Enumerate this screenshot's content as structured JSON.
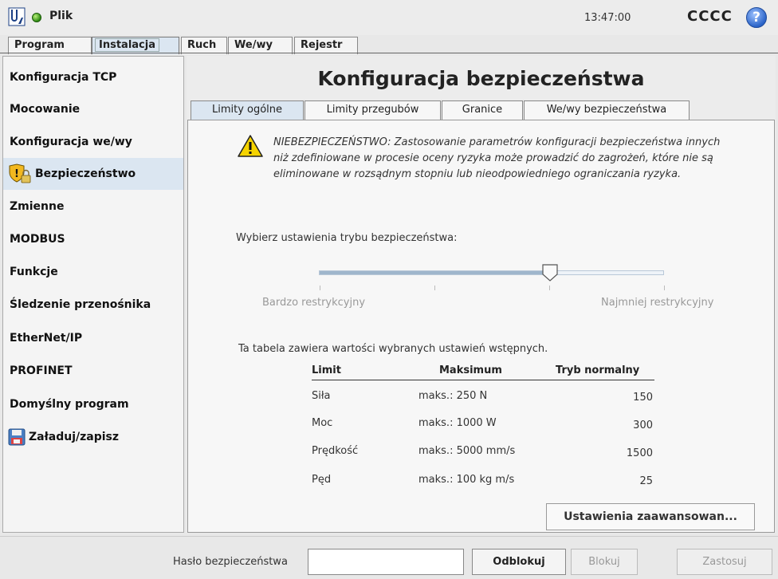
{
  "header": {
    "file_menu": "Plik",
    "clock": "13:47:00",
    "robot_name": "CCCC",
    "help": "?"
  },
  "main_tabs": [
    {
      "label": "Program"
    },
    {
      "label": "Instalacja"
    },
    {
      "label": "Ruch"
    },
    {
      "label": "We/wy"
    },
    {
      "label": "Rejestr"
    }
  ],
  "sidebar": {
    "items": [
      {
        "label": "Konfiguracja TCP"
      },
      {
        "label": "Mocowanie"
      },
      {
        "label": "Konfiguracja we/wy"
      },
      {
        "label": "Bezpieczeństwo"
      },
      {
        "label": "Zmienne"
      },
      {
        "label": "MODBUS"
      },
      {
        "label": "Funkcje"
      },
      {
        "label": "Śledzenie przenośnika"
      },
      {
        "label": "EtherNet/IP"
      },
      {
        "label": "PROFINET"
      },
      {
        "label": "Domyślny program"
      },
      {
        "label": "Załaduj/zapisz"
      }
    ]
  },
  "page": {
    "title": "Konfiguracja bezpieczeństwa",
    "sub_tabs": [
      {
        "label": "Limity ogólne"
      },
      {
        "label": "Limity przegubów"
      },
      {
        "label": "Granice"
      },
      {
        "label": "We/wy bezpieczeństwa"
      }
    ],
    "warning": "NIEBEZPIECZEŃSTWO: Zastosowanie parametrów konfiguracji bezpieczeństwa innych niż zdefiniowane w procesie oceny ryzyka może prowadzić do zagrożeń, które nie są eliminowane w rozsądnym stopniu lub nieodpowiedniego ograniczania ryzyka.",
    "select_label": "Wybierz ustawienia trybu bezpieczeństwa:",
    "slider": {
      "min_label": "Bardzo restrykcyjny",
      "max_label": "Najmniej restrykcyjny",
      "value_fraction": 0.67
    },
    "table_caption": "Ta tabela zawiera wartości wybranych ustawień wstępnych.",
    "table": {
      "headers": [
        "Limit",
        "Maksimum",
        "Tryb normalny"
      ],
      "rows": [
        {
          "limit": "Siła",
          "max": "maks.: 250 N",
          "normal": "150"
        },
        {
          "limit": "Moc",
          "max": "maks.: 1000 W",
          "normal": "300"
        },
        {
          "limit": "Prędkość",
          "max": "maks.: 5000 mm/s",
          "normal": "1500"
        },
        {
          "limit": "Pęd",
          "max": "maks.: 100 kg m/s",
          "normal": "25"
        }
      ]
    },
    "advanced_button": "Ustawienia zaawansowan..."
  },
  "footer": {
    "password_label": "Hasło bezpieczeństwa",
    "password_value": "",
    "unlock": "Odblokuj",
    "lock": "Blokuj",
    "apply": "Zastosuj"
  }
}
